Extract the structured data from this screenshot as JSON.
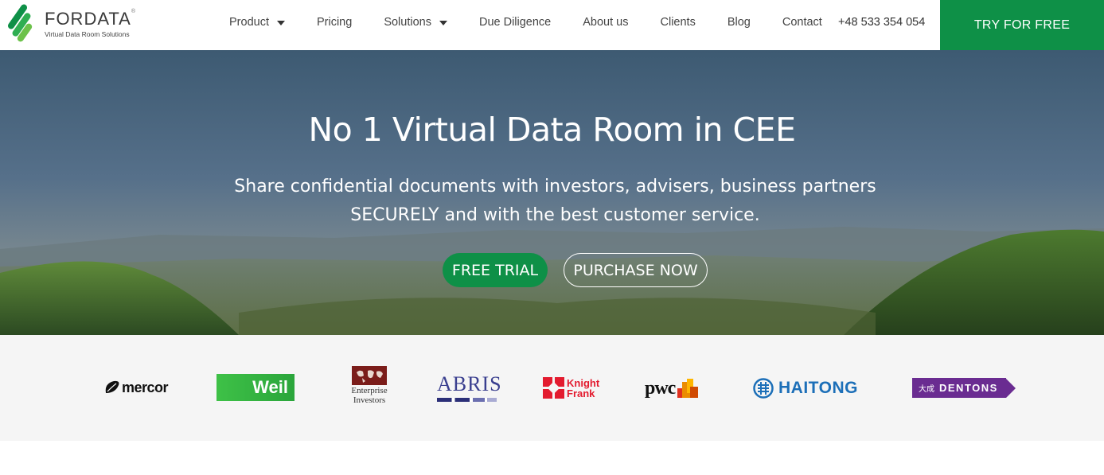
{
  "header": {
    "logo_name": "FORDATA",
    "logo_reg": "®",
    "logo_tagline": "Virtual Data Room Solutions",
    "nav": [
      {
        "label": "Product",
        "dropdown": true
      },
      {
        "label": "Pricing",
        "dropdown": false
      },
      {
        "label": "Solutions",
        "dropdown": true
      },
      {
        "label": "Due Diligence",
        "dropdown": false
      },
      {
        "label": "About us",
        "dropdown": false
      },
      {
        "label": "Clients",
        "dropdown": false
      },
      {
        "label": "Blog",
        "dropdown": false
      },
      {
        "label": "Contact",
        "dropdown": false
      }
    ],
    "phone": "+48 533 354 054",
    "cta_label": "TRY FOR FREE"
  },
  "hero": {
    "title": "No 1 Virtual Data Room in CEE",
    "subtitle_line1": "Share confidential documents with investors, advisers, business partners",
    "subtitle_line2": "SECURELY and with the best customer service.",
    "primary_button": "FREE TRIAL",
    "secondary_button": "PURCHASE NOW"
  },
  "clients": {
    "mercor": "mercor",
    "weil": "Weil",
    "ei_line1": "Enterprise",
    "ei_line2": "Investors",
    "abris": "ABRIS",
    "kf_line1": "Knight",
    "kf_line2": "Frank",
    "pwc": "pwc",
    "haitong": "HAITONG",
    "dentons_cn": "大成",
    "dentons": "DENTONS"
  },
  "colors": {
    "brand_green": "#0e9047",
    "text_dark": "#444444",
    "band_bg": "#f5f5f5"
  },
  "icons": {
    "logo": "fordata-stripes-icon",
    "dropdown": "caret-down-icon"
  }
}
